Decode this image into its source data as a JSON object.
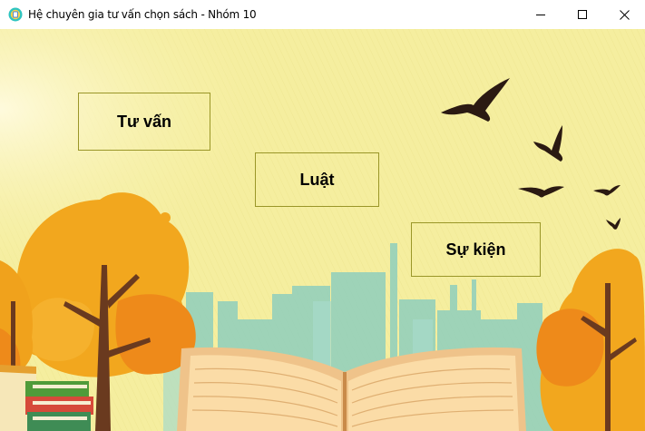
{
  "window": {
    "title": "Hệ chuyên gia tư vấn chọn sách - Nhóm 10",
    "icon": "app-icon",
    "controls": {
      "minimize_icon": "minimize-icon",
      "maximize_icon": "maximize-icon",
      "close_icon": "close-icon"
    }
  },
  "menu": {
    "consult_label": "Tư vấn",
    "rules_label": "Luật",
    "events_label": "Sự kiện"
  },
  "colors": {
    "background": "#f5ee9f",
    "button_border": "#9a9628",
    "tree_orange": "#f0a21c",
    "city_teal": "#8ccdbb",
    "bird": "#2b1a12"
  }
}
